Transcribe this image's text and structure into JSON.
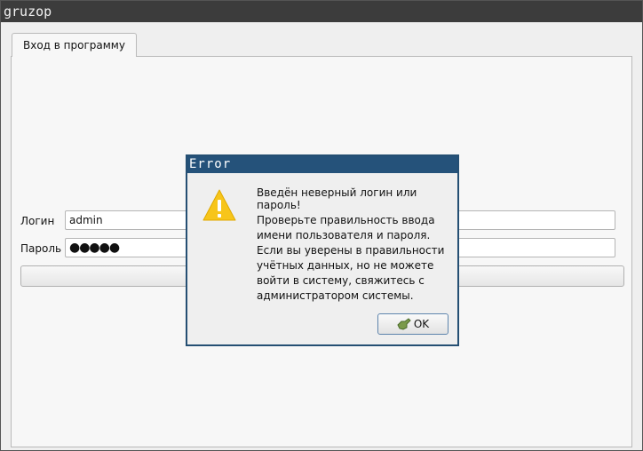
{
  "window": {
    "title": "gruzop"
  },
  "tabs": [
    {
      "label": "Вход в программу"
    }
  ],
  "form": {
    "login_label": "Логин",
    "login_value": "admin",
    "password_label": "Пароль",
    "password_value": "●●●●●",
    "login_button_label": ""
  },
  "dialog": {
    "title": "Error",
    "icon": "warning-icon",
    "message_title": "Введён неверный логин или пароль!",
    "message_body": "Проверьте правильность ввода имени пользователя и пароля. Если вы уверены в правильности учётных данных, но не можете войти в систему, свяжитесь с администратором системы.",
    "ok_label": "OK"
  },
  "colors": {
    "dialog_title_bg": "#25527a",
    "warning_yellow": "#f7c51a"
  }
}
